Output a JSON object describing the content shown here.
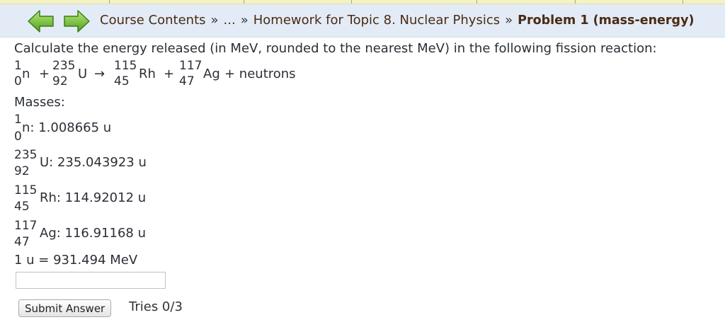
{
  "nav": {
    "back_icon": "green-left-arrow",
    "forward_icon": "green-right-arrow",
    "crumbs": [
      "Course Contents",
      "...",
      "Homework for Topic 8. Nuclear Physics"
    ],
    "separator": "»",
    "current": "Problem 1 (mass-energy)"
  },
  "problem": {
    "question": "Calculate the energy released (in MeV, rounded to the nearest MeV) in the following fission reaction:",
    "reaction": {
      "n": {
        "mass": "1",
        "atomic": "0",
        "symbol": "n"
      },
      "plus1": "+",
      "u": {
        "mass": "235",
        "atomic": "92",
        "symbol": "U"
      },
      "arrow": "→",
      "rh": {
        "mass": "115",
        "atomic": "45",
        "symbol": "Rh"
      },
      "plus2": "+",
      "ag": {
        "mass": "117",
        "atomic": "47",
        "symbol": "Ag"
      },
      "tail": "+ neutrons"
    },
    "masses_label": "Masses:",
    "masses": [
      {
        "mass": "1",
        "atomic": "0",
        "text": "n: 1.008665 u"
      },
      {
        "mass": "235",
        "atomic": "92",
        "text": "U: 235.043923 u"
      },
      {
        "mass": "115",
        "atomic": "45",
        "text": "Rh: 114.92012 u"
      },
      {
        "mass": "117",
        "atomic": "47",
        "text": "Ag: 116.91168 u"
      }
    ],
    "conversion": "1 u = 931.494 MeV"
  },
  "answer": {
    "value": "",
    "placeholder": "",
    "submit_label": "Submit Answer",
    "tries": "Tries 0/3"
  }
}
